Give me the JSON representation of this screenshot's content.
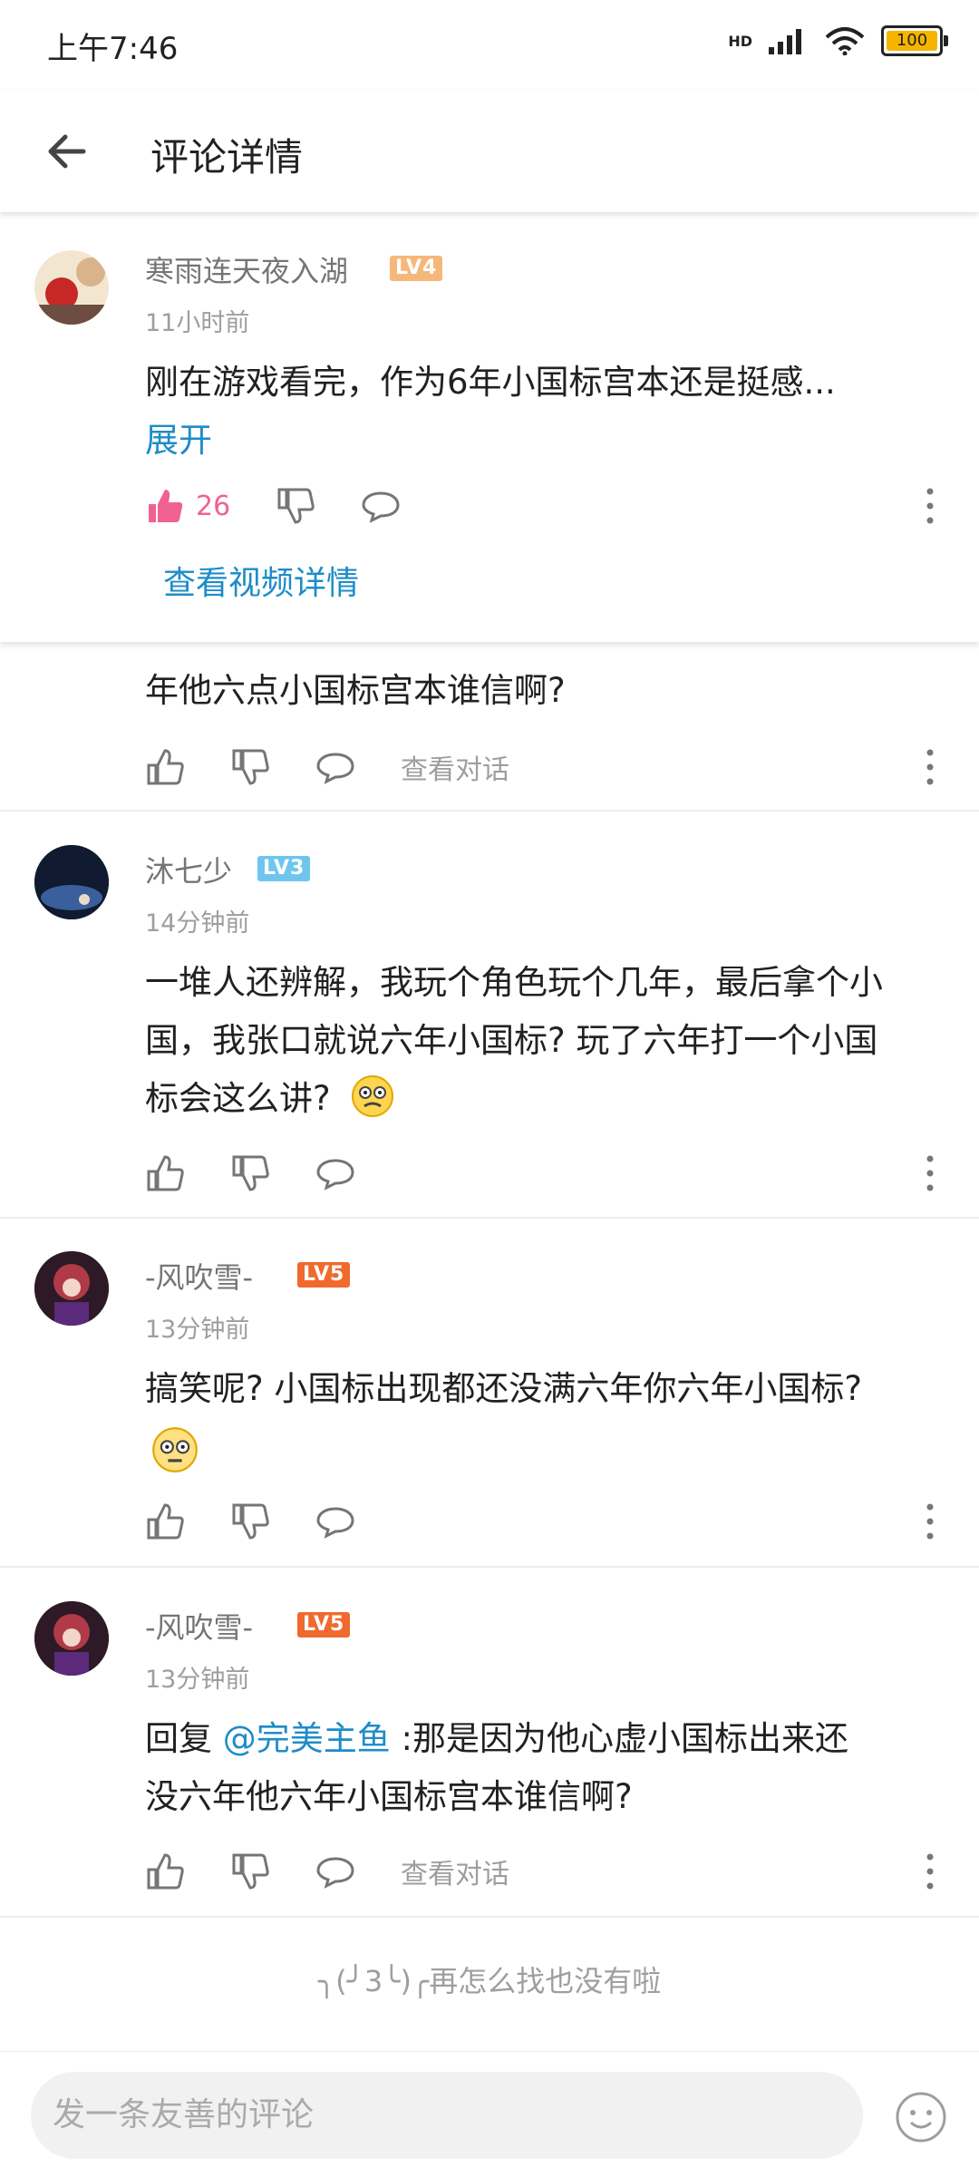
{
  "status_bar": {
    "time": "上午7:46",
    "network": "HD",
    "battery": "100"
  },
  "header": {
    "title": "评论详情"
  },
  "pinned_comment": {
    "user": "寒雨连天夜入湖",
    "level": "LV4",
    "time": "11小时前",
    "text": "刚在游戏看完，作为6年小国标宫本还是挺感...",
    "expand": "展开",
    "likes": "26",
    "view_video": "查看视频详情"
  },
  "partial_reply": {
    "text": "年他六点小国标宫本谁信啊?",
    "view_conversation": "查看对话"
  },
  "comments": [
    {
      "user": "沐七少",
      "level": "LV3",
      "time": "14分钟前",
      "line1": "一堆人还辨解，我玩个角色玩个几年，最后拿个小",
      "line2": "国，我张口就说六年小国标? 玩了六年打一个小国",
      "line3": "标会这么讲?"
    },
    {
      "user": "-风吹雪-",
      "level": "LV5",
      "time": "13分钟前",
      "line1": "搞笑呢? 小国标出现都还没满六年你六年小国标?"
    },
    {
      "user": "-风吹雪-",
      "level": "LV5",
      "time": "13分钟前",
      "reply_prefix": "回复 ",
      "mention": "@完美主鱼",
      "line1_rest": " :那是因为他心虚小国标出来还",
      "line2": "没六年他六年小国标宫本谁信啊?",
      "view_conversation": "查看对话"
    }
  ],
  "footer_note": "╮(╯3╰)╭再怎么找也没有啦",
  "input": {
    "placeholder": "发一条友善的评论"
  },
  "colors": {
    "accent_blue": "#1e8cc8",
    "like_pink": "#f06292",
    "lv4": "#f5b87a",
    "lv3": "#6ec6ee",
    "lv5": "#f06a2e"
  }
}
